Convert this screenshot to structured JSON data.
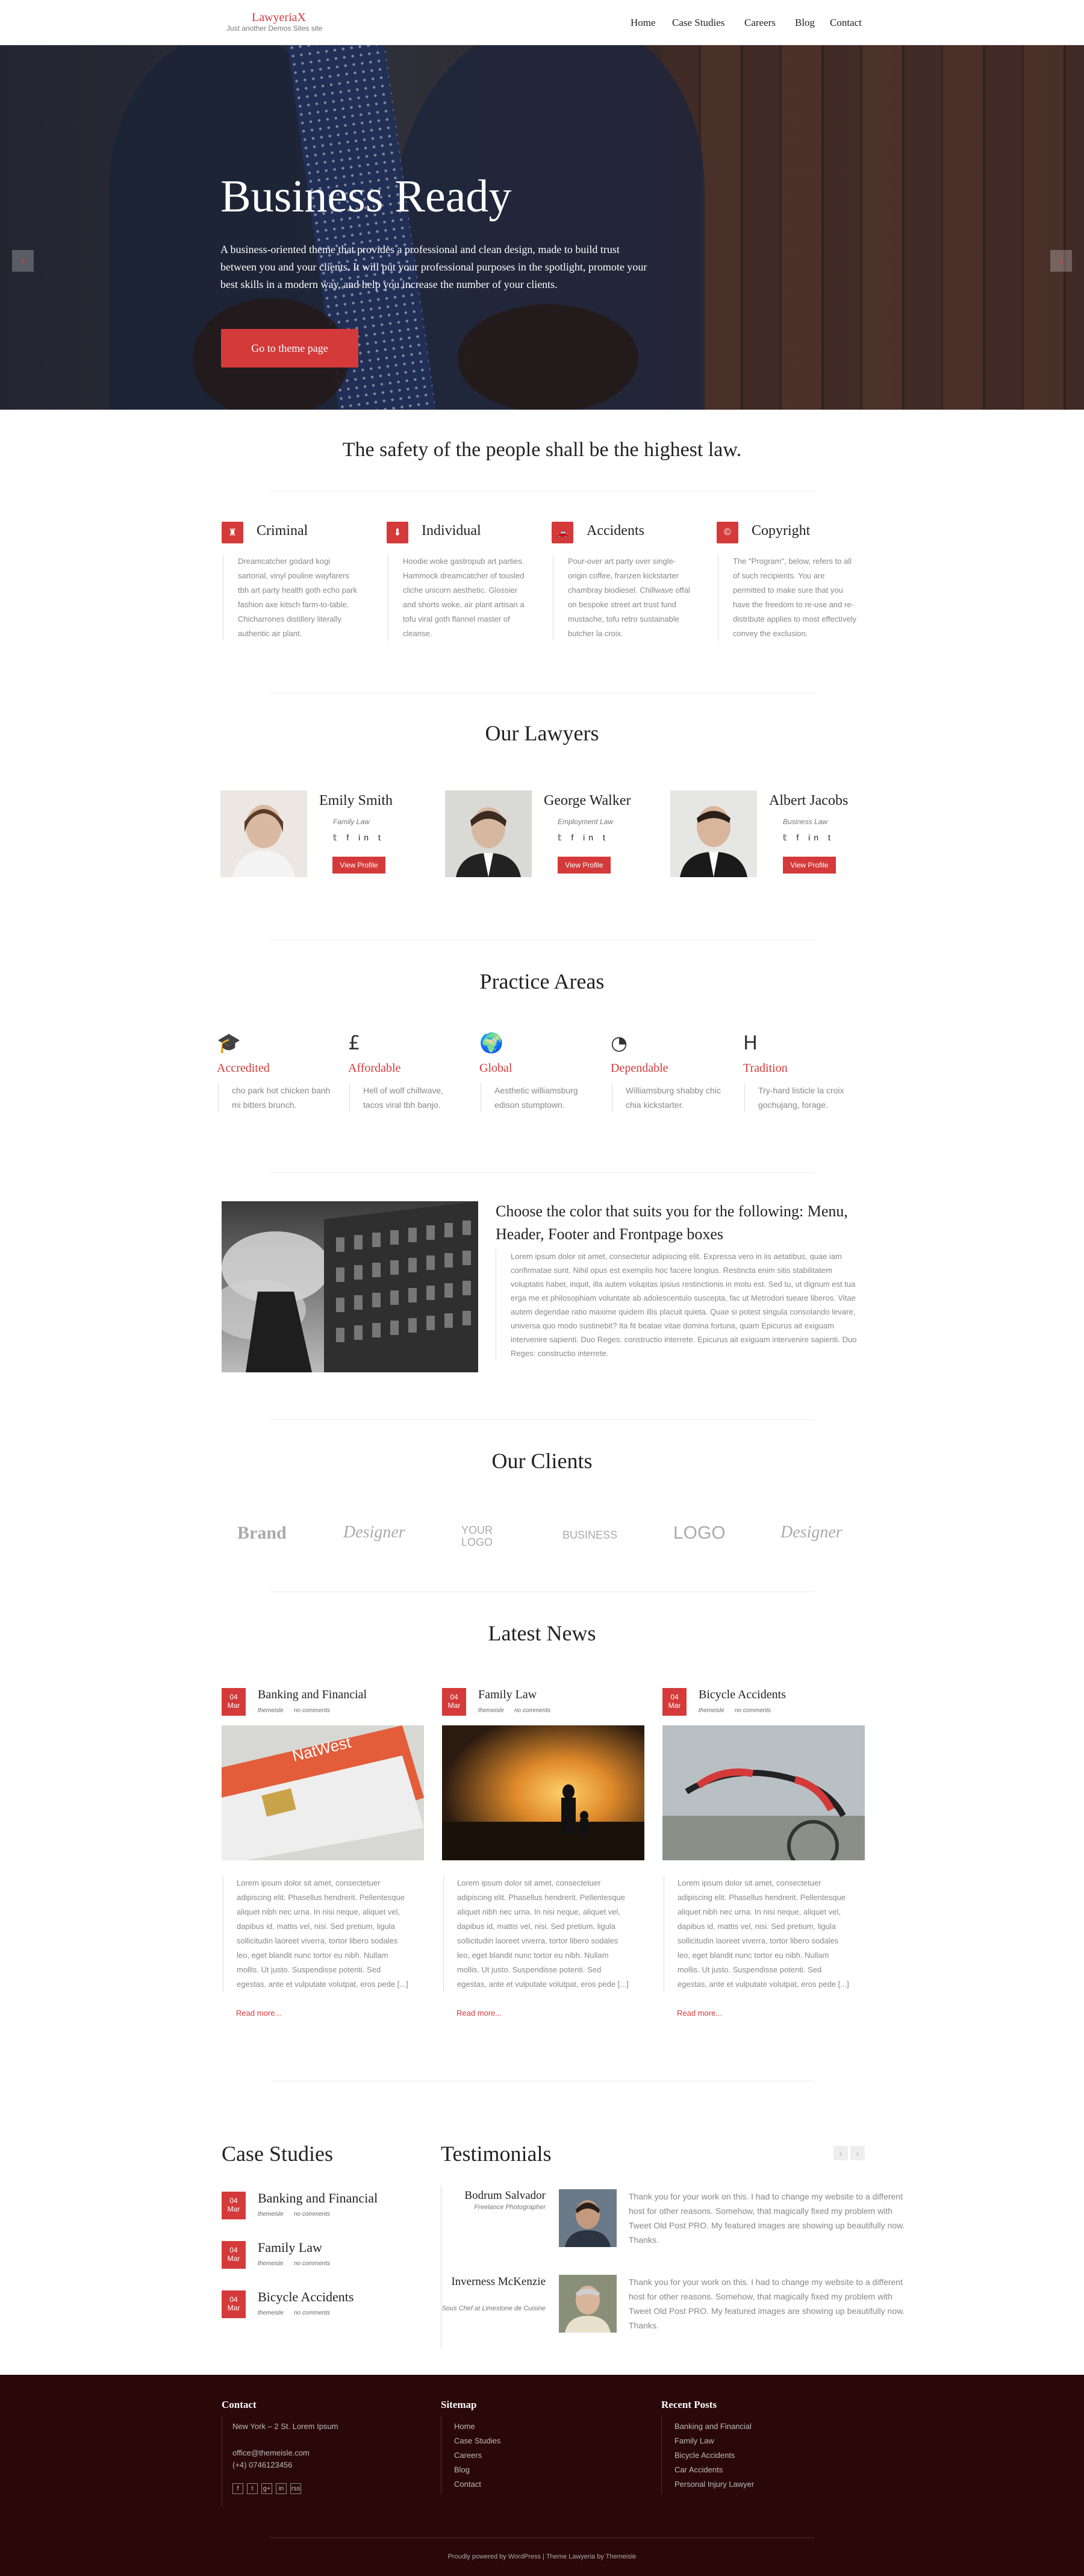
{
  "header": {
    "logo_title": "LawyeriaX",
    "logo_subtitle": "Just another Demos Sites site",
    "nav": [
      "Home",
      "Case Studies",
      "Careers",
      "Blog",
      "Contact"
    ],
    "active_nav": "Home"
  },
  "hero": {
    "title": "Business Ready",
    "text": "A business-oriented theme that provides a professional and clean design, made to build trust between you and your clients. It will put your professional purposes in the spotlight, promote your best skills in a modern way, and help you increase the number of your clients.",
    "button": "Go to theme page",
    "prev_arrow": "‹",
    "next_arrow": "›"
  },
  "safety": {
    "title": "The safety of the people shall be the highest law.",
    "columns": [
      {
        "icon": "♜",
        "icon_name": "chess-rook-icon",
        "title": "Criminal",
        "text": "Dreamcatcher godard kogi sartorial, vinyl pouline wayfarers tbh art party health goth echo park fashion axe kitsch farm-to-table. Chicharrones distillery literally authentic air plant."
      },
      {
        "icon": "⬇",
        "icon_name": "download-icon",
        "title": "Individual",
        "text": "Hoodie woke gastropub art parties. Hammock dreamcatcher of tousled cliche unicorn aesthetic. Glossier and shorts woke, air plant artisan a tofu viral goth flannel master of cleanse."
      },
      {
        "icon": "🚗",
        "icon_name": "car-icon",
        "title": "Accidents",
        "text": "Pour-over art party over single-origin coffee, franzen kickstarter chambray biodiesel. Chillwave offal on bespoke street art trust fund mustache, tofu retro sustainable butcher la croix."
      },
      {
        "icon": "©",
        "icon_name": "copyright-icon",
        "title": "Copyright",
        "text": "The \"Program\", below, refers to all of such recipients. You are permitted to make sure that you have the freedom to re-use and re-distribute applies to most effectively convey the exclusion."
      }
    ]
  },
  "lawyers": {
    "title": "Our Lawyers",
    "items": [
      {
        "name": "Emily Smith",
        "role": "Family Law",
        "social": "𝕥 f in t",
        "button": "View Profile"
      },
      {
        "name": "George Walker",
        "role": "Employment Law",
        "social": "𝕥 f in t",
        "button": "View Profile"
      },
      {
        "name": "Albert Jacobs",
        "role": "Business Law",
        "social": "𝕥 f in t",
        "button": "View Profile"
      }
    ]
  },
  "practice": {
    "title": "Practice Areas",
    "items": [
      {
        "icon": "🎓",
        "icon_name": "graduation-cap-icon",
        "title": "Accredited",
        "text": "cho park hot chicken banh mi bitters brunch."
      },
      {
        "icon": "£",
        "icon_name": "pound-icon",
        "title": "Affordable",
        "text": "Hell of wolf chillwave, tacos viral tbh banjo."
      },
      {
        "icon": "🌍",
        "icon_name": "globe-icon",
        "title": "Global",
        "text": "Aesthetic williamsburg edison stumptown."
      },
      {
        "icon": "◔",
        "icon_name": "pie-chart-icon",
        "title": "Dependable",
        "text": "Williamsburg shabby chic chia kickstarter."
      },
      {
        "icon": "H",
        "icon_name": "header-icon",
        "title": "Tradition",
        "text": "Try-hard listicle la croix gochujang, forage."
      }
    ]
  },
  "color_section": {
    "title": "Choose the color that suits you for the following: Menu, Header, Footer and Frontpage boxes",
    "text": "Lorem ipsum dolor sit amet, consectetur adipiscing elit. Expressa vero in iis aetatibus, quae iam confirmatae sunt. Nihil opus est exemplis hoc facere longius. Restincta enim sitis stabilitatem voluptatis habet, inquit, illa autem voluptas ipsius restinctionis in motu est. Sed tu, ut dignum est tua erga me et philosophiam voluntate ab adolescentulo susceptа, fac ut Metrodori tueare liberos. Vitae autem degendae ratio maxime quidem illis placuit quieta. Quae si potest singula consolando levare, universa quo modo sustinebit? Ita fit beatae vitae domina fortuna, quam Epicurus ait exiguam intervenire sapienti. Duo Reges: constructio interrete. Epicurus ait exiguam intervenire sapienti. Duo Reges: constructio interrete."
  },
  "clients": {
    "title": "Our Clients",
    "logos": [
      "Brand",
      "Designer",
      "YOUR LOGO",
      "BUSINESS",
      "LOGO",
      "Designer"
    ]
  },
  "news": {
    "title": "Latest News",
    "items": [
      {
        "day": "04",
        "month": "Mar",
        "title": "Banking and Financial",
        "author": "themeisle",
        "comments": "no comments",
        "text": "Lorem ipsum dolor sit amet, consectetuer adipiscing elit. Phasellus hendrerit. Pellentesque aliquet nibh nec urna. In nisi neque, aliquet vel, dapibus id, mattis vel, nisi. Sed pretium, ligula sollicitudin laoreet viverra, tortor libero sodales leo, eget blandit nunc tortor eu nibh. Nullam mollis. Ut justo. Suspendisse potenti. Sed egestas, ante et vulputate volutpat, eros pede [...]",
        "readmore": "Read more..."
      },
      {
        "day": "04",
        "month": "Mar",
        "title": "Family Law",
        "author": "themeisle",
        "comments": "no comments",
        "text": "Lorem ipsum dolor sit amet, consectetuer adipiscing elit. Phasellus hendrerit. Pellentesque aliquet nibh nec urna. In nisi neque, aliquet vel, dapibus id, mattis vel, nisi. Sed pretium, ligula sollicitudin laoreet viverra, tortor libero sodales leo, eget blandit nunc tortor eu nibh. Nullam mollis. Ut justo. Suspendisse potenti. Sed egestas, ante et vulputate volutpat, eros pede [...]",
        "readmore": "Read more..."
      },
      {
        "day": "04",
        "month": "Mar",
        "title": "Bicycle Accidents",
        "author": "themeisle",
        "comments": "no comments",
        "text": "Lorem ipsum dolor sit amet, consectetuer adipiscing elit. Phasellus hendrerit. Pellentesque aliquet nibh nec urna. In nisi neque, aliquet vel, dapibus id, mattis vel, nisi. Sed pretium, ligula sollicitudin laoreet viverra, tortor libero sodales leo, eget blandit nunc tortor eu nibh. Nullam mollis. Ut justo. Suspendisse potenti. Sed egestas, ante et vulputate volutpat, eros pede [...]",
        "readmore": "Read more..."
      }
    ]
  },
  "case_studies": {
    "title": "Case Studies",
    "items": [
      {
        "day": "04",
        "month": "Mar",
        "title": "Banking and Financial",
        "author": "themeisle",
        "comments": "no comments"
      },
      {
        "day": "04",
        "month": "Mar",
        "title": "Family Law",
        "author": "themeisle",
        "comments": "no comments"
      },
      {
        "day": "04",
        "month": "Mar",
        "title": "Bicycle Accidents",
        "author": "themeisle",
        "comments": "no comments"
      }
    ]
  },
  "testimonials": {
    "title": "Testimonials",
    "prev": "‹",
    "next": "›",
    "items": [
      {
        "name": "Bodrum Salvador",
        "role": "Freelance Photographer",
        "text": "Thank you for your work on this. I had to change my website to a different host for other reasons. Somehow, that magically fixed my problem with Tweet Old Post PRO. My featured images are showing up beautifully now. Thanks."
      },
      {
        "name": "Inverness McKenzie",
        "role": "Sous Chef at Limestone de Cuisine",
        "text": "Thank you for your work on this. I had to change my website to a different host for other reasons. Somehow, that magically fixed my problem with Tweet Old Post PRO. My featured images are showing up beautifully now. Thanks."
      }
    ]
  },
  "footer": {
    "contact": {
      "title": "Contact",
      "address": "New York – 2 St. Lorem Ipsum",
      "email": "office@themeisle.com",
      "phone": "(+4) 0746123456",
      "social": [
        "f",
        "t",
        "g+",
        "in",
        "rss"
      ]
    },
    "sitemap": {
      "title": "Sitemap",
      "items": [
        "Home",
        "Case Studies",
        "Careers",
        "Blog",
        "Contact"
      ]
    },
    "recent": {
      "title": "Recent Posts",
      "items": [
        "Banking and Financial",
        "Family Law",
        "Bicycle Accidents",
        "Car Accidents",
        "Personal Injury Lawyer"
      ]
    },
    "copyright": "Proudly powered by WordPress | Theme Lawyeria by Themeisle"
  },
  "colors": {
    "accent": "#d43a3a",
    "footer_bg": "#2a0807"
  }
}
